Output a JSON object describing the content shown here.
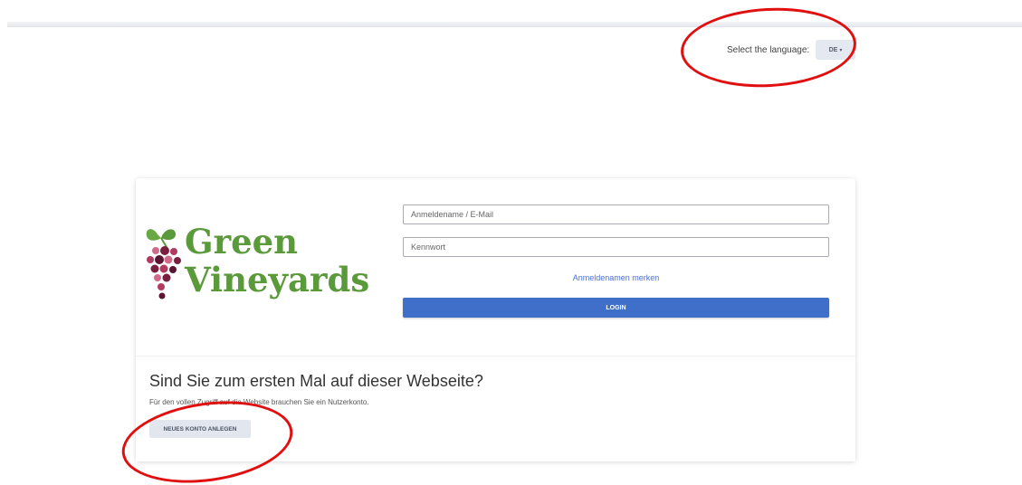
{
  "language": {
    "label": "Select the language:",
    "selected": "DE",
    "caret": "▾"
  },
  "login": {
    "username_placeholder": "Anmeldename / E-Mail",
    "password_placeholder": "Kennwort",
    "remember_label": "Anmeldenamen merken",
    "login_button": "LOGIN"
  },
  "logo": {
    "line1": "Green",
    "line2": "Vineyards",
    "color": "#5a9a3a",
    "grape_color": "#7a1f3d"
  },
  "first_visit": {
    "title": "Sind Sie zum ersten Mal auf dieser Webseite?",
    "subtitle": "Für den vollen Zugriff auf die Website brauchen Sie ein Nutzerkonto.",
    "button": "NEUES KONTO ANLEGEN"
  },
  "colors": {
    "primary": "#3f6fc8",
    "link": "#4a6fd0",
    "annotation": "#e01010"
  }
}
